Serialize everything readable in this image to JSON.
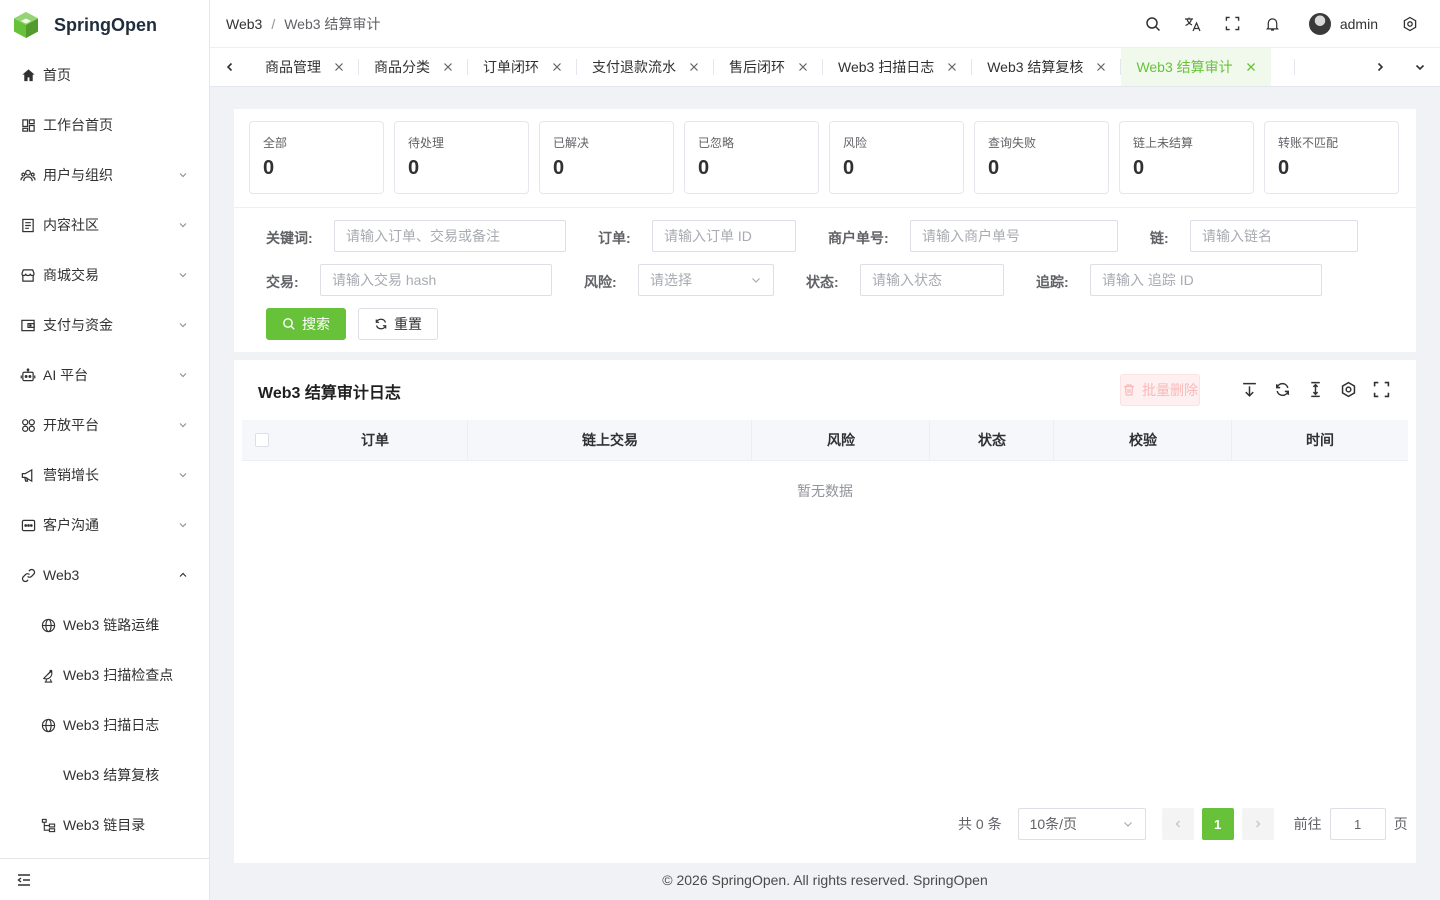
{
  "app": {
    "name": "SpringOpen"
  },
  "sidebar": {
    "items": [
      {
        "label": "首页",
        "icon": "home-icon"
      },
      {
        "label": "工作台首页",
        "icon": "dashboard-icon"
      },
      {
        "label": "用户与组织",
        "icon": "users-icon",
        "expandable": true
      },
      {
        "label": "内容社区",
        "icon": "document-icon",
        "expandable": true
      },
      {
        "label": "商城交易",
        "icon": "shop-icon",
        "expandable": true
      },
      {
        "label": "支付与资金",
        "icon": "wallet-icon",
        "expandable": true
      },
      {
        "label": "AI 平台",
        "icon": "robot-icon",
        "expandable": true
      },
      {
        "label": "开放平台",
        "icon": "grid-icon",
        "expandable": true
      },
      {
        "label": "营销增长",
        "icon": "megaphone-icon",
        "expandable": true
      },
      {
        "label": "客户沟通",
        "icon": "chat-icon",
        "expandable": true
      },
      {
        "label": "Web3",
        "icon": "link-icon",
        "expanded": true
      }
    ],
    "web3_children": [
      {
        "label": "Web3 链路运维",
        "icon": "globe-icon"
      },
      {
        "label": "Web3 扫描检查点",
        "icon": "satellite-icon"
      },
      {
        "label": "Web3 扫描日志",
        "icon": "globe-icon"
      },
      {
        "label": "Web3 结算复核",
        "icon": ""
      },
      {
        "label": "Web3 链目录",
        "icon": "tree-icon"
      }
    ]
  },
  "header": {
    "breadcrumb": [
      "Web3",
      "Web3 结算审计"
    ],
    "username": "admin"
  },
  "tabs": [
    {
      "label": "商品管理"
    },
    {
      "label": "商品分类"
    },
    {
      "label": "订单闭环"
    },
    {
      "label": "支付退款流水"
    },
    {
      "label": "售后闭环"
    },
    {
      "label": "Web3 扫描日志"
    },
    {
      "label": "Web3 结算复核"
    },
    {
      "label": "Web3 结算审计",
      "active": true
    }
  ],
  "stats": [
    {
      "label": "全部",
      "value": "0"
    },
    {
      "label": "待处理",
      "value": "0"
    },
    {
      "label": "已解决",
      "value": "0"
    },
    {
      "label": "已忽略",
      "value": "0"
    },
    {
      "label": "风险",
      "value": "0"
    },
    {
      "label": "查询失败",
      "value": "0"
    },
    {
      "label": "链上未结算",
      "value": "0"
    },
    {
      "label": "转账不匹配",
      "value": "0"
    }
  ],
  "filters": {
    "keyword": {
      "label": "关键词:",
      "placeholder": "请输入订单、交易或备注"
    },
    "order": {
      "label": "订单:",
      "placeholder": "请输入订单 ID"
    },
    "merchant": {
      "label": "商户单号:",
      "placeholder": "请输入商户单号"
    },
    "chain": {
      "label": "链:",
      "placeholder": "请输入链名"
    },
    "tx": {
      "label": "交易:",
      "placeholder": "请输入交易 hash"
    },
    "risk": {
      "label": "风险:",
      "placeholder": "请选择"
    },
    "status": {
      "label": "状态:",
      "placeholder": "请输入状态"
    },
    "trace": {
      "label": "追踪:",
      "placeholder": "请输入 追踪 ID"
    },
    "search_label": "搜索",
    "reset_label": "重置"
  },
  "table": {
    "title": "Web3 结算审计日志",
    "batch_delete_label": "批量删除",
    "columns": [
      "订单",
      "链上交易",
      "风险",
      "状态",
      "校验",
      "时间"
    ],
    "empty_text": "暂无数据"
  },
  "pagination": {
    "total": "共 0 条",
    "page_size": "10条/页",
    "current_page": "1",
    "goto_label": "前往",
    "goto_value": "1",
    "goto_suffix": "页"
  },
  "footer": {
    "text": "© 2026 SpringOpen. All rights reserved. SpringOpen"
  },
  "colors": {
    "primary": "#67c23a",
    "active_tab_bg": "#f0f9eb",
    "danger_disabled_bg": "#fef0f0"
  }
}
